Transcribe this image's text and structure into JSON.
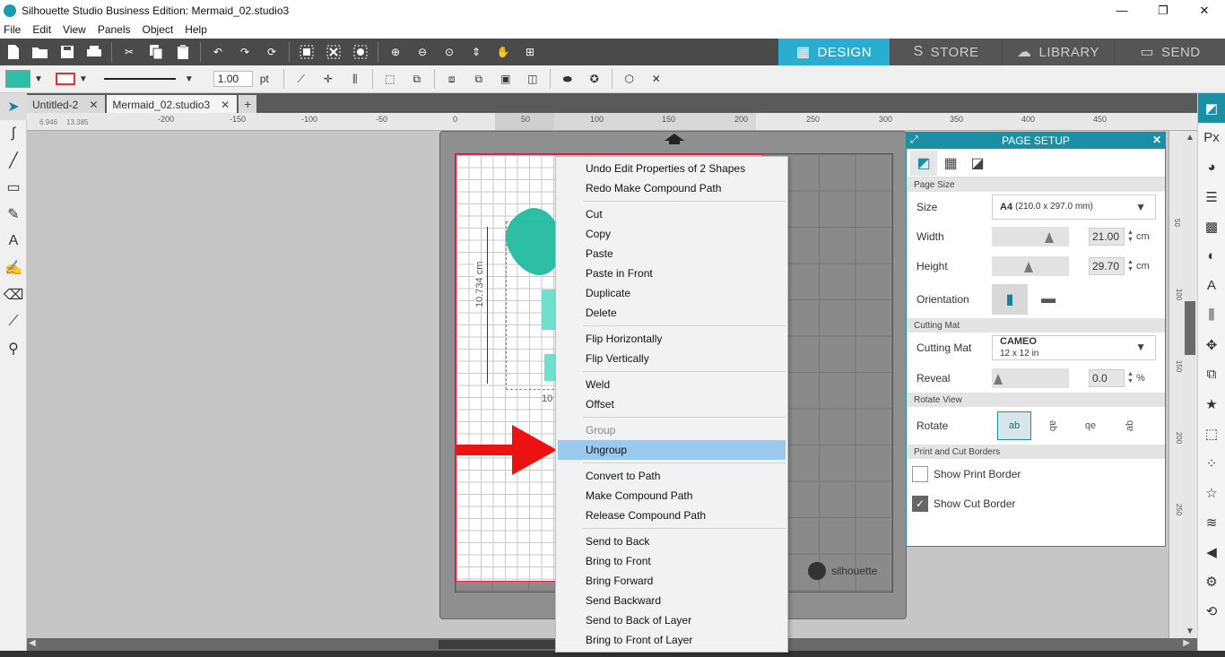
{
  "window": {
    "title": "Silhouette Studio Business Edition: Mermaid_02.studio3",
    "minimize": "—",
    "restore": "❐",
    "close": "✕"
  },
  "menu": [
    "File",
    "Edit",
    "View",
    "Panels",
    "Object",
    "Help"
  ],
  "modes": [
    {
      "label": "DESIGN",
      "icon": "▦"
    },
    {
      "label": "STORE",
      "icon": "S"
    },
    {
      "label": "LIBRARY",
      "icon": "☁"
    },
    {
      "label": "SEND",
      "icon": "▭"
    }
  ],
  "line_toolbar": {
    "stroke_width": "1.00",
    "stroke_unit": "pt",
    "fill_color": "#2cbfa6",
    "stroke_color": "#dd3333"
  },
  "tabs": [
    {
      "label": "Untitled-2",
      "close": "✕"
    },
    {
      "label": "Mermaid_02.studio3",
      "close": "✕"
    }
  ],
  "tab_add": "+",
  "ruler": {
    "coord_x": "6.946",
    "coord_y": "13.385",
    "ticks": [
      "-200",
      "-150",
      "-100",
      "-50",
      "0",
      "50",
      "100",
      "150",
      "200",
      "250",
      "300",
      "350",
      "400",
      "450"
    ],
    "right_ticks": [
      "50",
      "100",
      "150",
      "200",
      "250"
    ]
  },
  "canvas": {
    "dimension_vertical": "10.734 cm",
    "dimension_horizontal": "10",
    "brand": "silhouette"
  },
  "context_menu": {
    "items": [
      {
        "label": "Undo Edit Properties of 2 Shapes",
        "state": "normal"
      },
      {
        "label": "Redo Make Compound Path",
        "state": "normal"
      },
      {
        "sep": true
      },
      {
        "label": "Cut",
        "state": "normal"
      },
      {
        "label": "Copy",
        "state": "normal"
      },
      {
        "label": "Paste",
        "state": "normal"
      },
      {
        "label": "Paste in Front",
        "state": "normal"
      },
      {
        "label": "Duplicate",
        "state": "normal"
      },
      {
        "label": "Delete",
        "state": "normal"
      },
      {
        "sep": true
      },
      {
        "label": "Flip Horizontally",
        "state": "normal"
      },
      {
        "label": "Flip Vertically",
        "state": "normal"
      },
      {
        "sep": true
      },
      {
        "label": "Weld",
        "state": "normal"
      },
      {
        "label": "Offset",
        "state": "normal"
      },
      {
        "sep": true
      },
      {
        "label": "Group",
        "state": "disabled"
      },
      {
        "label": "Ungroup",
        "state": "highlighted"
      },
      {
        "sep": true
      },
      {
        "label": "Convert to Path",
        "state": "normal"
      },
      {
        "label": "Make Compound Path",
        "state": "normal"
      },
      {
        "label": "Release Compound Path",
        "state": "normal"
      },
      {
        "sep": true
      },
      {
        "label": "Send to Back",
        "state": "normal"
      },
      {
        "label": "Bring to Front",
        "state": "normal"
      },
      {
        "label": "Bring Forward",
        "state": "normal"
      },
      {
        "label": "Send Backward",
        "state": "normal"
      },
      {
        "label": "Send to Back of Layer",
        "state": "normal"
      },
      {
        "label": "Bring to Front of Layer",
        "state": "normal"
      }
    ]
  },
  "page_setup": {
    "title": "PAGE SETUP",
    "close": "✕",
    "sections": {
      "page_size": "Page Size",
      "cutting_mat": "Cutting Mat",
      "rotate_view": "Rotate View",
      "borders": "Print and Cut Borders"
    },
    "size_label": "Size",
    "size_value_main": "A4",
    "size_value_detail": "(210.0 x 297.0 mm)",
    "width_label": "Width",
    "width_value": "21.00",
    "height_label": "Height",
    "height_value": "29.70",
    "unit_cm": "cm",
    "orientation_label": "Orientation",
    "mat_label": "Cutting Mat",
    "mat_value": "CAMEO",
    "mat_detail": "12 x 12 in",
    "reveal_label": "Reveal",
    "reveal_value": "0.0",
    "reveal_unit": "%",
    "rotate_label": "Rotate",
    "rotate_options": [
      "ab",
      "ab",
      "qe",
      "ab"
    ],
    "show_print_border": "Show Print Border",
    "show_print_border_checked": false,
    "show_cut_border": "Show Cut Border",
    "show_cut_border_checked": true,
    "width_slider_fraction": 0.75,
    "height_slider_fraction": 0.45,
    "reveal_slider_fraction": 0.0
  },
  "colors": {
    "accent": "#29aed1",
    "panel_header": "#1a8fa5",
    "highlight": "#99c9ef",
    "arrow_red": "#ee1111"
  }
}
